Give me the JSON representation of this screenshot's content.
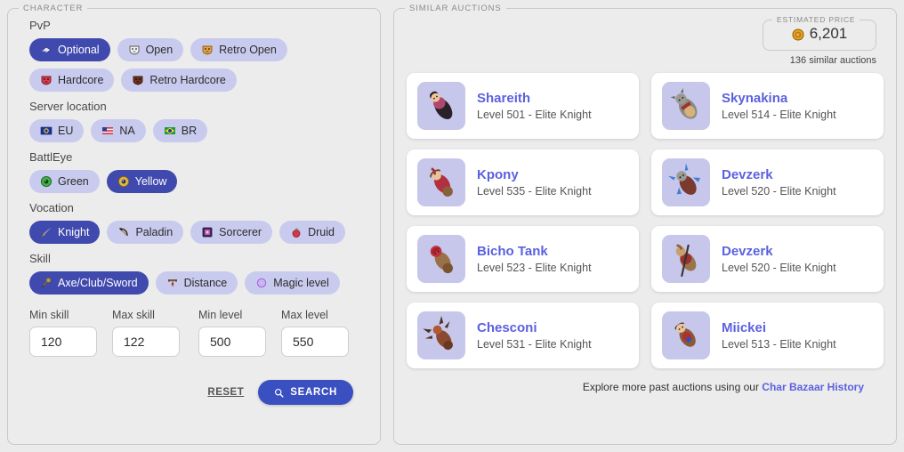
{
  "colors": {
    "page_bg": "#ebebeb",
    "accent_active": "#4049ad",
    "chip_bg": "#c9cbee",
    "search_btn": "#3a4fc0",
    "link": "#5b61e0",
    "avatar_bg": "#c6c7ea",
    "coin_gold": "#e8a21c"
  },
  "left": {
    "legend": "CHARACTER",
    "groups": [
      {
        "label": "PvP",
        "rows": [
          [
            {
              "label": "Optional",
              "icon": "pvp-optional-icon",
              "active": true
            },
            {
              "label": "Open",
              "icon": "pvp-open-icon",
              "active": false
            },
            {
              "label": "Retro Open",
              "icon": "pvp-retro-open-icon",
              "active": false
            }
          ],
          [
            {
              "label": "Hardcore",
              "icon": "pvp-hardcore-icon",
              "active": false
            },
            {
              "label": "Retro Hardcore",
              "icon": "pvp-retro-hardcore-icon",
              "active": false
            }
          ]
        ]
      },
      {
        "label": "Server location",
        "rows": [
          [
            {
              "label": "EU",
              "icon": "flag-eu-icon",
              "active": false
            },
            {
              "label": "NA",
              "icon": "flag-na-icon",
              "active": false
            },
            {
              "label": "BR",
              "icon": "flag-br-icon",
              "active": false
            }
          ]
        ]
      },
      {
        "label": "BattlEye",
        "rows": [
          [
            {
              "label": "Green",
              "icon": "battleye-green-icon",
              "active": false
            },
            {
              "label": "Yellow",
              "icon": "battleye-yellow-icon",
              "active": true
            }
          ]
        ]
      },
      {
        "label": "Vocation",
        "rows": [
          [
            {
              "label": "Knight",
              "icon": "sword-icon",
              "active": true
            },
            {
              "label": "Paladin",
              "icon": "bow-icon",
              "active": false
            },
            {
              "label": "Sorcerer",
              "icon": "spellbook-icon",
              "active": false
            },
            {
              "label": "Druid",
              "icon": "apple-icon",
              "active": false
            }
          ]
        ]
      },
      {
        "label": "Skill",
        "rows": [
          [
            {
              "label": "Axe/Club/Sword",
              "icon": "club-icon",
              "active": true
            },
            {
              "label": "Distance",
              "icon": "crossbow-icon",
              "active": false
            },
            {
              "label": "Magic level",
              "icon": "magic-icon",
              "active": false
            }
          ]
        ]
      }
    ],
    "fields": [
      {
        "label": "Min skill",
        "value": "120",
        "placeholder": "Min skill"
      },
      {
        "label": "Max skill",
        "value": "122",
        "placeholder": "Max skill"
      },
      {
        "label": "Min level",
        "value": "500",
        "placeholder": "Min level"
      },
      {
        "label": "Max level",
        "value": "550",
        "placeholder": "Max level"
      }
    ],
    "reset_label": "RESET",
    "search_label": "SEARCH",
    "search_icon": "search-icon"
  },
  "right": {
    "legend": "SIMILAR AUCTIONS",
    "price": {
      "legend": "ESTIMATED PRICE",
      "value": "6,201",
      "coin_icon": "tibia-coin-icon",
      "count_text": "136 similar auctions"
    },
    "cards": [
      {
        "name": "Shareith",
        "sub": "Level 501 - Elite Knight",
        "avatar": "character-sprite-shareith"
      },
      {
        "name": "Skynakina",
        "sub": "Level 514 - Elite Knight",
        "avatar": "character-sprite-skynakina"
      },
      {
        "name": "Kpony",
        "sub": "Level 535 - Elite Knight",
        "avatar": "character-sprite-kpony"
      },
      {
        "name": "Devzerk",
        "sub": "Level 520 - Elite Knight",
        "avatar": "character-sprite-devzerk-1"
      },
      {
        "name": "Bicho Tank",
        "sub": "Level 523 - Elite Knight",
        "avatar": "character-sprite-bicho-tank"
      },
      {
        "name": "Devzerk",
        "sub": "Level 520 - Elite Knight",
        "avatar": "character-sprite-devzerk-2"
      },
      {
        "name": "Chesconi",
        "sub": "Level 531 - Elite Knight",
        "avatar": "character-sprite-chesconi"
      },
      {
        "name": "Miickei",
        "sub": "Level 513 - Elite Knight",
        "avatar": "character-sprite-miickei"
      }
    ],
    "footer_prefix": "Explore more past auctions using our ",
    "footer_link": "Char Bazaar History"
  }
}
